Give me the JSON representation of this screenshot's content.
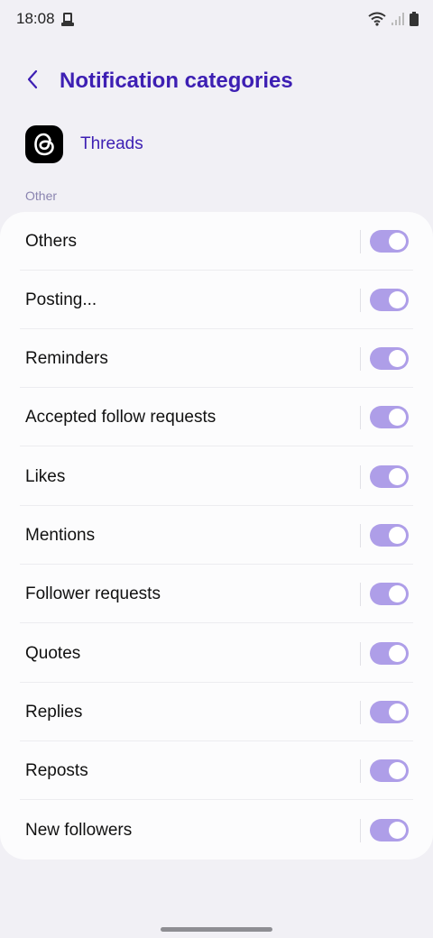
{
  "status_bar": {
    "time": "18:08",
    "icons": [
      "screenshot-icon",
      "wifi-icon",
      "signal-icon",
      "battery-icon"
    ]
  },
  "header": {
    "back_icon": "chevron-left-icon",
    "title": "Notification categories"
  },
  "app": {
    "icon": "threads-logo",
    "name": "Threads"
  },
  "section": {
    "label": "Other"
  },
  "categories": [
    {
      "label": "Others",
      "enabled": true
    },
    {
      "label": "Posting...",
      "enabled": true
    },
    {
      "label": "Reminders",
      "enabled": true
    },
    {
      "label": "Accepted follow requests",
      "enabled": true
    },
    {
      "label": "Likes",
      "enabled": true
    },
    {
      "label": "Mentions",
      "enabled": true
    },
    {
      "label": "Follower requests",
      "enabled": true
    },
    {
      "label": "Quotes",
      "enabled": true
    },
    {
      "label": "Replies",
      "enabled": true
    },
    {
      "label": "Reposts",
      "enabled": true
    },
    {
      "label": "New followers",
      "enabled": true
    }
  ],
  "colors": {
    "accent": "#3d1fb3",
    "toggle_on": "#ae9ee8",
    "background": "#f1f0f5",
    "card": "#fcfcfd"
  }
}
